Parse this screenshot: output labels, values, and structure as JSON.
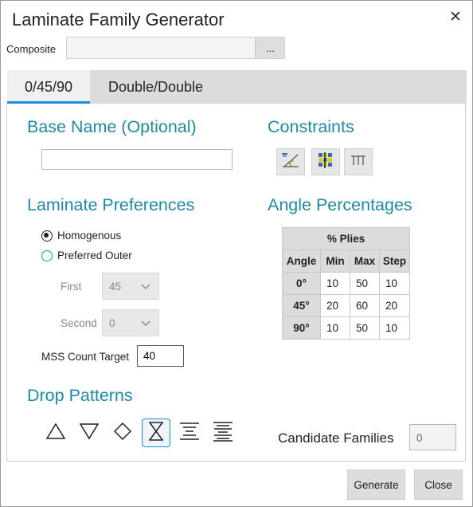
{
  "window": {
    "title": "Laminate Family Generator",
    "close_glyph": "✕"
  },
  "composite": {
    "label": "Composite",
    "value": "",
    "browse_label": "..."
  },
  "tabs": [
    {
      "label": "0/45/90",
      "active": true
    },
    {
      "label": "Double/Double",
      "active": false
    }
  ],
  "base_name": {
    "heading": "Base Name (Optional)",
    "value": ""
  },
  "constraints": {
    "heading": "Constraints",
    "buttons": [
      "angle-constraint-icon",
      "color-grid-icon",
      "column-constraint-icon"
    ]
  },
  "laminate_preferences": {
    "heading": "Laminate Preferences",
    "options": [
      {
        "label": "Homogenous",
        "selected": true
      },
      {
        "label": "Preferred Outer",
        "selected": false
      }
    ],
    "first": {
      "label": "First",
      "value": "45"
    },
    "second": {
      "label": "Second",
      "value": "0"
    },
    "mss": {
      "label": "MSS Count Target",
      "value": "40"
    }
  },
  "angle_percentages": {
    "heading": "Angle Percentages",
    "group_header": "% Plies",
    "columns": [
      "Angle",
      "Min",
      "Max",
      "Step"
    ],
    "rows": [
      {
        "angle": "0°",
        "min": "10",
        "max": "50",
        "step": "10"
      },
      {
        "angle": "45°",
        "min": "20",
        "max": "60",
        "step": "20"
      },
      {
        "angle": "90°",
        "min": "10",
        "max": "50",
        "step": "10"
      }
    ]
  },
  "drop_patterns": {
    "heading": "Drop Patterns",
    "items": [
      "triangle-up-icon",
      "triangle-down-icon",
      "diamond-icon",
      "hourglass-icon",
      "center-lines-narrow-icon",
      "center-lines-wide-icon"
    ],
    "selected": "hourglass-icon"
  },
  "candidate_families": {
    "label": "Candidate Families",
    "value": "0"
  },
  "footer": {
    "generate_label": "Generate",
    "close_label": "Close"
  },
  "colors": {
    "accent": "#1a8fd6",
    "heading": "#1e8aa6",
    "tab_bar": "#dcdcdc"
  }
}
